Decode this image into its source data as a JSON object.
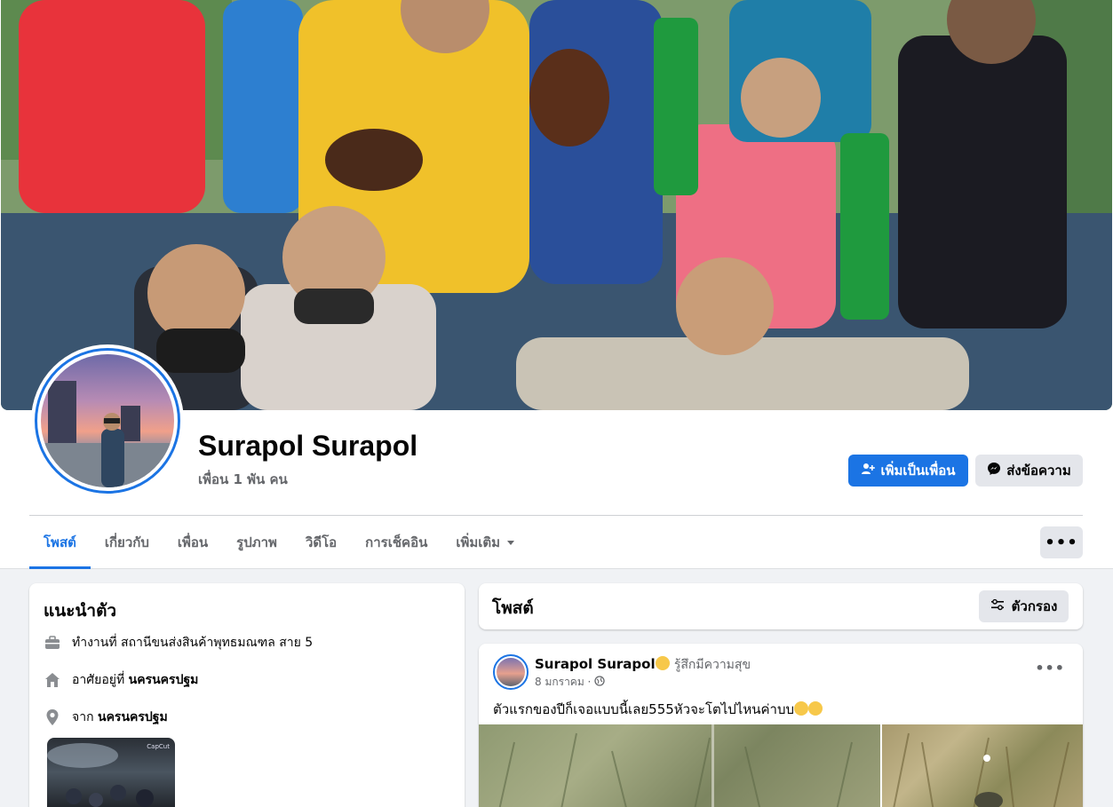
{
  "colors": {
    "accent": "#1b74e4",
    "secondary_button": "#e4e6eb",
    "page_bg": "#f0f2f5",
    "muted_text": "#65676b"
  },
  "profile": {
    "name": "Surapol Surapol",
    "friends": "เพื่อน 1 พัน คน",
    "add_friend_label": "เพิ่มเป็นเพื่อน",
    "message_label": "ส่งข้อความ"
  },
  "tabs": [
    {
      "label": "โพสต์",
      "active": true
    },
    {
      "label": "เกี่ยวกับ"
    },
    {
      "label": "เพื่อน"
    },
    {
      "label": "รูปภาพ"
    },
    {
      "label": "วิดีโอ"
    },
    {
      "label": "การเช็คอิน"
    },
    {
      "label": "เพิ่มเติม"
    }
  ],
  "more_options": "•••",
  "intro": {
    "title": "แนะนำตัว",
    "work": "ทำงานที่ สถานีขนส่งสินค้าพุทธมณฑล สาย 5",
    "lives_prefix": "อาศัยอยู่ที่",
    "lives_place": "นครนครปฐม",
    "from_prefix": "จาก",
    "from_place": "นครนครปฐม",
    "thumb_watermark": "CapCut"
  },
  "posts": {
    "title": "โพสต์",
    "filter_label": "ตัวกรอง",
    "post": {
      "author": "Surapol Surapol",
      "feeling": "รู้สึกมีความสุข",
      "date": "8 มกราคม ·",
      "text": "ตัวแรกของปีก็เจอแบบนี้เลย555หัวจะโตไปไหนค่าบบ",
      "menu": "•••"
    }
  }
}
